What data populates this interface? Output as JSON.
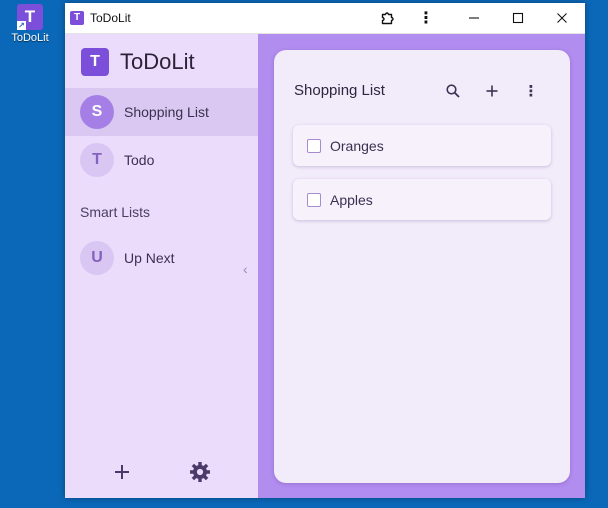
{
  "desktop": {
    "shortcut_label": "ToDoLit",
    "shortcut_letter": "T"
  },
  "window": {
    "title": "ToDoLit",
    "icon_letter": "T",
    "more_glyph": "⋮"
  },
  "sidebar": {
    "brand_letter": "T",
    "brand_name": "ToDoLit",
    "lists": [
      {
        "initial": "S",
        "label": "Shopping List",
        "active": true
      },
      {
        "initial": "T",
        "label": "Todo",
        "active": false
      }
    ],
    "smart_lists_title": "Smart Lists",
    "smart_lists": [
      {
        "initial": "U",
        "label": "Up Next"
      }
    ],
    "collapse_glyph": "‹"
  },
  "main": {
    "list_title": "Shopping List",
    "more_glyph": "⋮",
    "items": [
      {
        "label": "Oranges",
        "checked": false
      },
      {
        "label": "Apples",
        "checked": false
      }
    ]
  },
  "colors": {
    "accent": "#7b4fd9",
    "sidebar_bg": "#ebdcfc",
    "main_bg": "#b28df0",
    "card_bg": "#f2ebfa",
    "desktop_bg": "#0b68b8"
  }
}
